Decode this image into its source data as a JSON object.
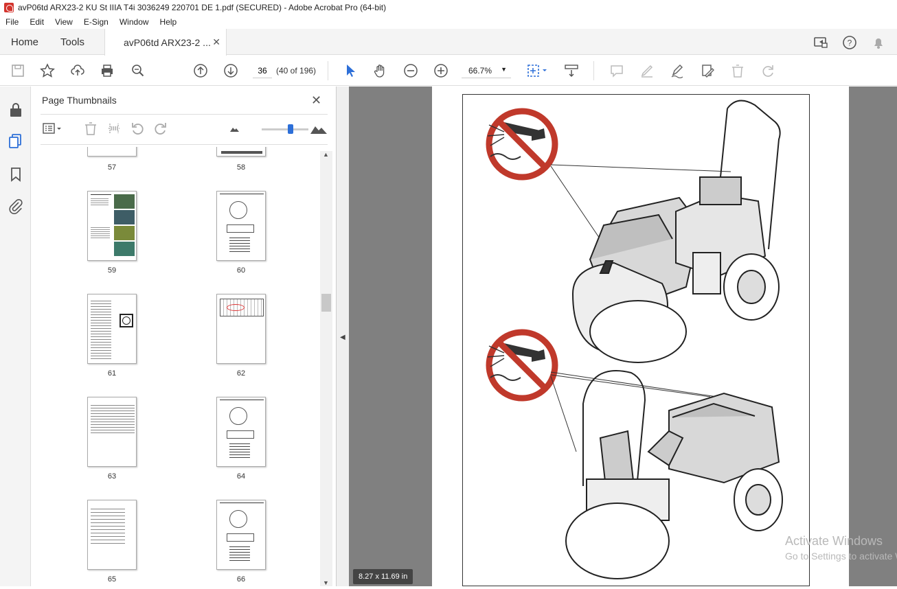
{
  "window": {
    "title": "avP06td ARX23-2 KU St IIIA T4i 3036249 220701 DE 1.pdf (SECURED) - Adobe Acrobat Pro (64-bit)"
  },
  "menu": [
    "File",
    "Edit",
    "View",
    "E-Sign",
    "Window",
    "Help"
  ],
  "tabs": {
    "home": "Home",
    "tools": "Tools",
    "doc": "avP06td ARX23-2 ..."
  },
  "toolbar": {
    "page_current": "36",
    "page_of": "(40 of 196)",
    "zoom": "66.7%"
  },
  "panel": {
    "title": "Page Thumbnails"
  },
  "thumbnails": [
    {
      "label": "57"
    },
    {
      "label": "58"
    },
    {
      "label": "59"
    },
    {
      "label": "60"
    },
    {
      "label": "61"
    },
    {
      "label": "62"
    },
    {
      "label": "63"
    },
    {
      "label": "64"
    },
    {
      "label": "65"
    },
    {
      "label": "66"
    }
  ],
  "viewer": {
    "page_size": "8.27 x 11.69 in"
  },
  "watermark": {
    "line1": "Activate Windows",
    "line2": "Go to Settings to activate Windows."
  },
  "colors": {
    "accent": "#2d6fd8",
    "prohibition": "#c0392b",
    "viewer_bg": "#808080"
  }
}
